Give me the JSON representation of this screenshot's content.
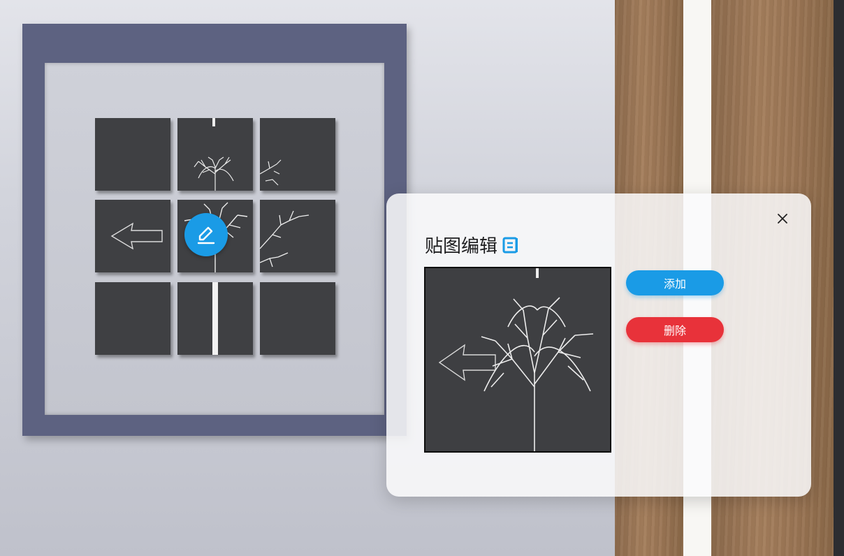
{
  "panel": {
    "title": "贴图编辑",
    "title_icon": "document-icon",
    "close_icon": "close-icon",
    "buttons": {
      "add": "添加",
      "delete": "删除"
    }
  },
  "scene": {
    "edit_icon": "pencil-icon"
  },
  "colors": {
    "accent": "#1a9be6",
    "danger": "#e8323a",
    "frame": "#5d6281",
    "tile": "#3f4043"
  }
}
